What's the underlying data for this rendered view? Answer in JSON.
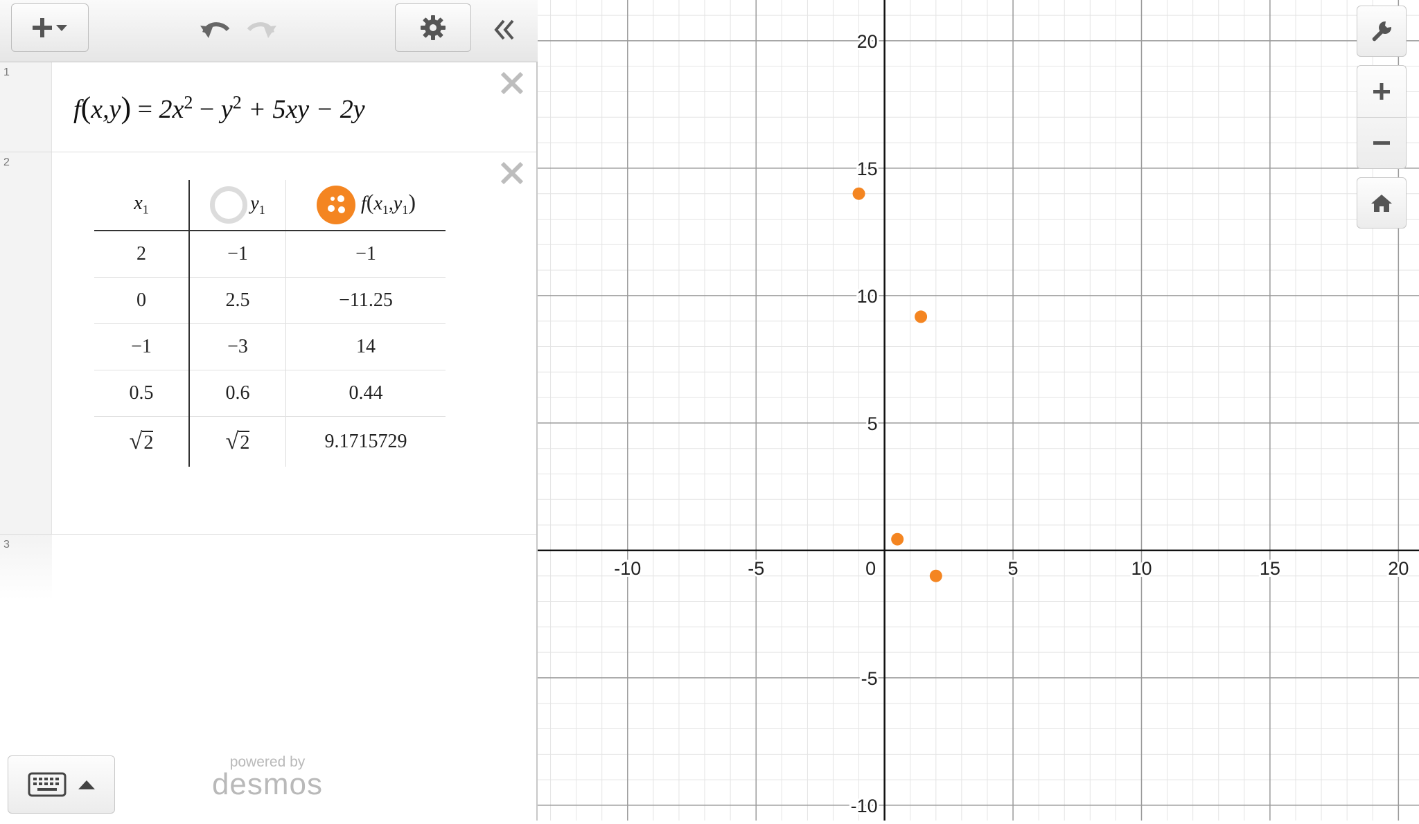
{
  "toolbar": {
    "add_icon": "plus-dropdown-icon",
    "undo_icon": "undo-icon",
    "redo_icon": "redo-icon",
    "settings_icon": "gear-icon",
    "collapse_icon": "double-chevron-left-icon"
  },
  "expressions": [
    {
      "index": "1",
      "latex_text": "f(x,y) = 2x² − y² + 5xy − 2y",
      "parts": {
        "f": "f",
        "args": "x,y",
        "eq": "=",
        "t1": "2x",
        "e1": "2",
        "t2": "−",
        "t3": "y",
        "e2": "2",
        "t4": "+ 5xy − 2y"
      }
    },
    {
      "index": "2",
      "table": {
        "headers": [
          "x1",
          "y1",
          "f(x1,y1)"
        ],
        "h1_base": "x",
        "h1_sub": "1",
        "h2_base": "y",
        "h2_sub": "1",
        "h3_f": "f",
        "h3_x": "x",
        "h3_xs": "1",
        "h3_y": "y",
        "h3_ys": "1",
        "rows": [
          [
            "2",
            "−1",
            "−1"
          ],
          [
            "0",
            "2.5",
            "−11.25"
          ],
          [
            "−1",
            "−3",
            "14"
          ],
          [
            "0.5",
            "0.6",
            "0.44"
          ],
          [
            "√2",
            "√2",
            "9.1715729"
          ]
        ],
        "sqrt_radicand": "2",
        "point_color": "#f48521"
      }
    },
    {
      "index": "3"
    }
  ],
  "branding": {
    "powered_by": "powered by",
    "name": "desmos"
  },
  "graph_controls": {
    "wrench_icon": "wrench-icon",
    "zoom_in_icon": "plus-icon",
    "zoom_out_icon": "minus-icon",
    "home_icon": "home-icon",
    "keyboard_icon": "keyboard-icon",
    "keyboard_toggle_icon": "caret-up-icon"
  },
  "chart_data": {
    "type": "scatter",
    "x_ticks": [
      "-10",
      "-5",
      "0",
      "5",
      "10",
      "15",
      "20"
    ],
    "y_ticks": [
      "-10",
      "-5",
      "5",
      "10",
      "15",
      "20"
    ],
    "x_tick_values": [
      -10,
      -5,
      0,
      5,
      10,
      15,
      20
    ],
    "y_tick_values": [
      -10,
      -5,
      5,
      10,
      15,
      20
    ],
    "xlim": [
      -13.5,
      20.8
    ],
    "ylim": [
      -10.6,
      21.6
    ],
    "grid": true,
    "minor_step": 1,
    "major_step": 5,
    "points": [
      {
        "x": -1,
        "y": 14
      },
      {
        "x": 1.4142136,
        "y": 9.1715729
      },
      {
        "x": 0.5,
        "y": 0.44
      },
      {
        "x": 2,
        "y": -1
      }
    ],
    "color": "#f48521"
  }
}
